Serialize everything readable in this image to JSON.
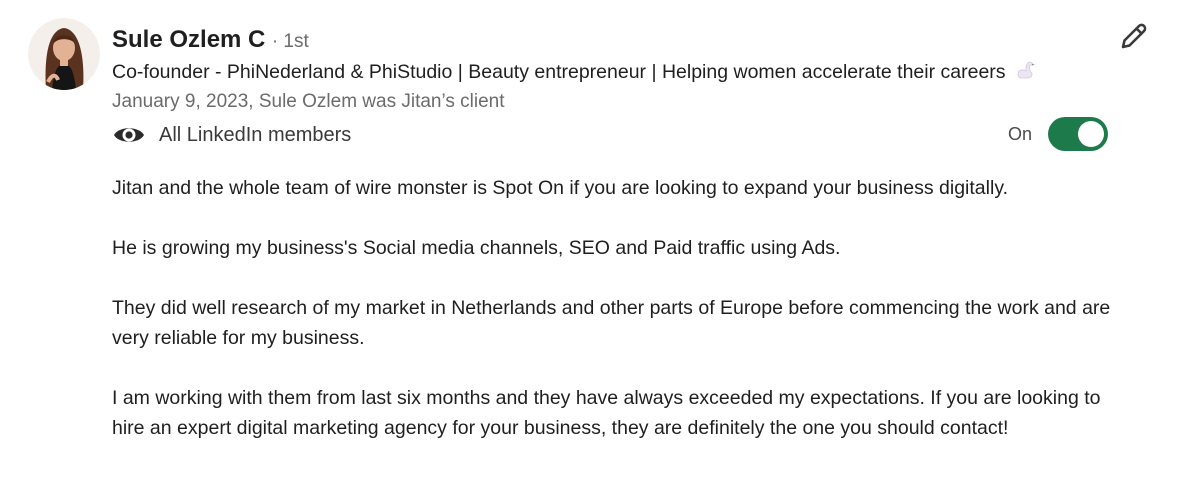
{
  "author": {
    "name": "Sule Ozlem C",
    "connection": "· 1st",
    "headline": "Co-founder - PhiNederland & PhiStudio | Beauty entrepreneur | Helping women accelerate their careers",
    "headline_emoji_icon": "swan-icon"
  },
  "recommendation_meta": "January 9, 2023, Sule Ozlem was Jitan’s client",
  "visibility": {
    "icon": "eye-icon",
    "label": "All LinkedIn members"
  },
  "toggle": {
    "label": "On",
    "state": true,
    "color": "#1d7a4a"
  },
  "edit": {
    "icon": "pencil-icon"
  },
  "paragraphs": [
    "Jitan and the whole team of wire monster is Spot On if you are looking to expand your business digitally.",
    "He is growing my business's Social media channels, SEO and Paid traffic using Ads.",
    "They did well research of my market in Netherlands and other parts of Europe before commencing the work and are very reliable for my business.",
    "I am working with them from last six months and they have always exceeded my expectations. If you are looking to hire an expert digital marketing agency for your business, they are definitely the one you should contact!"
  ]
}
